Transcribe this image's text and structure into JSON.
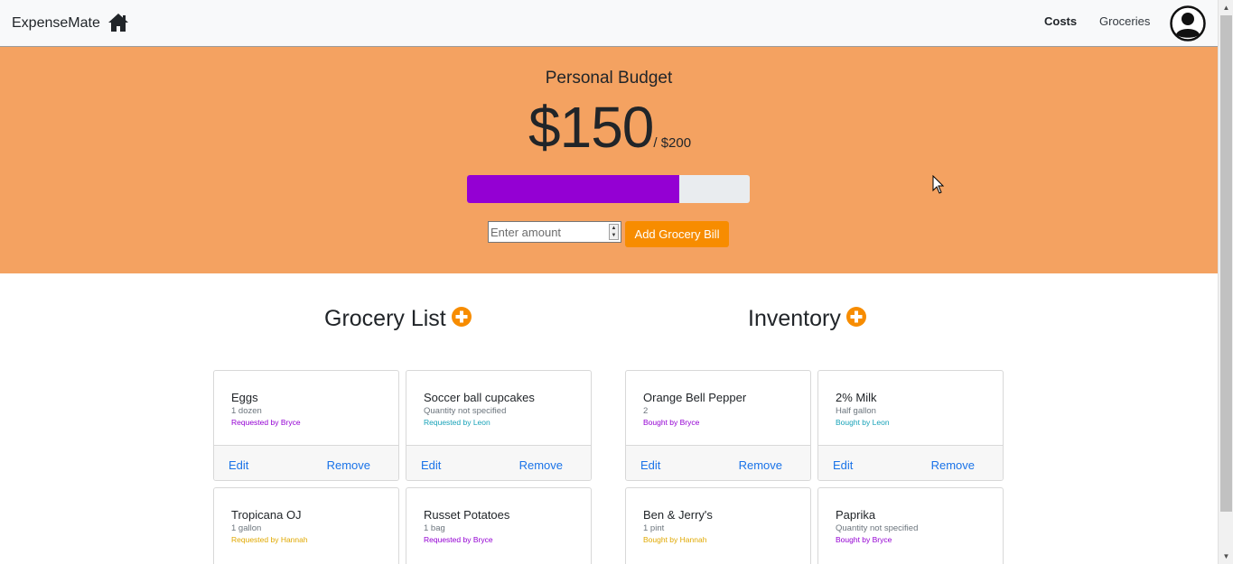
{
  "nav": {
    "brand": "ExpenseMate",
    "home_icon": "home-icon",
    "links": [
      "Costs",
      "Groceries"
    ],
    "active": "Costs",
    "avatar_icon": "user-circle-icon"
  },
  "budget": {
    "title": "Personal Budget",
    "amount": "$150",
    "total": "/ $200",
    "progress_fraction": 0.75,
    "progress_color": "#9400d3",
    "input_placeholder": "Enter amount",
    "add_button": "Add Grocery Bill"
  },
  "colors": {
    "hero_bg": "#f4a261",
    "accent": "#f78c00",
    "bryce": "#9400d3",
    "leon": "#17a2b8",
    "hannah": "#e0a800"
  },
  "grocery_list": {
    "title": "Grocery List",
    "add_icon": "plus-circle-icon",
    "items": [
      {
        "name": "Eggs",
        "qty": "1 dozen",
        "who": "Requested by Bryce",
        "color": "#9400d3"
      },
      {
        "name": "Soccer ball cupcakes",
        "qty": "Quantity not specified",
        "who": "Requested by Leon",
        "color": "#17a2b8"
      },
      {
        "name": "Tropicana OJ",
        "qty": "1 gallon",
        "who": "Requested by Hannah",
        "color": "#e0a800"
      },
      {
        "name": "Russet Potatoes",
        "qty": "1 bag",
        "who": "Requested by Bryce",
        "color": "#9400d3"
      }
    ]
  },
  "inventory": {
    "title": "Inventory",
    "add_icon": "plus-circle-icon",
    "items": [
      {
        "name": "Orange Bell Pepper",
        "qty": "2",
        "who": "Bought by Bryce",
        "color": "#9400d3"
      },
      {
        "name": "2% Milk",
        "qty": "Half gallon",
        "who": "Bought by Leon",
        "color": "#17a2b8"
      },
      {
        "name": "Ben & Jerry's",
        "qty": "1 pint",
        "who": "Bought by Hannah",
        "color": "#e0a800"
      },
      {
        "name": "Paprika",
        "qty": "Quantity not specified",
        "who": "Bought by Bryce",
        "color": "#9400d3"
      }
    ]
  },
  "card_actions": {
    "edit": "Edit",
    "remove": "Remove"
  }
}
